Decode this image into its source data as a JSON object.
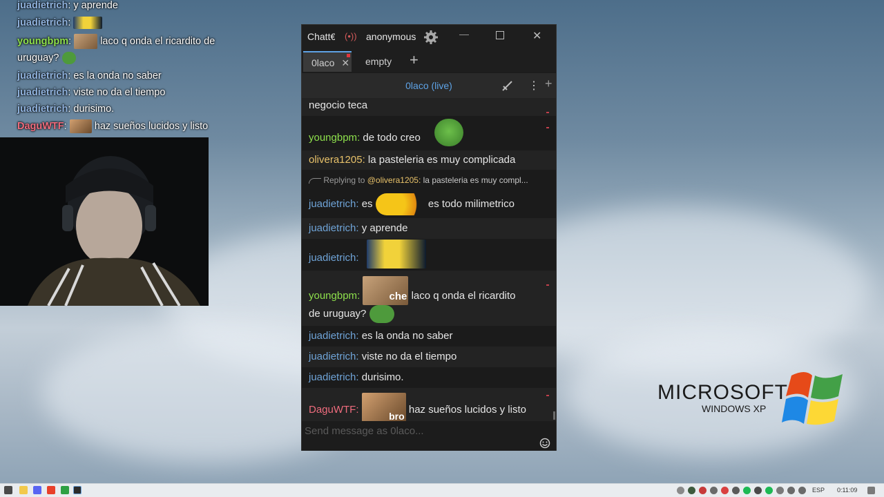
{
  "overlay_chat": [
    {
      "user": "juadietrich",
      "sep": ":",
      "text": "y aprende",
      "color": "#8fb1dc"
    },
    {
      "user": "juadietrich",
      "sep": ":",
      "text": "",
      "color": "#8fb1dc",
      "emote": "minion-emote"
    },
    {
      "user": "youngbpm",
      "sep": ":",
      "text": "laco q onda el ricardito de",
      "color": "#8ee04c",
      "emote": "cat-che-emote"
    },
    {
      "user": "",
      "sep": "",
      "text": "uruguay?",
      "color": "#ffffff",
      "emote": "pepe-emote"
    },
    {
      "user": "juadietrich",
      "sep": ":",
      "text": "es la onda no saber",
      "color": "#8fb1dc"
    },
    {
      "user": "juadietrich",
      "sep": ":",
      "text": "viste no da el tiempo",
      "color": "#8fb1dc"
    },
    {
      "user": "juadietrich",
      "sep": ":",
      "text": "durisimo.",
      "color": "#8fb1dc"
    },
    {
      "user": "DaguWTF",
      "sep": ":",
      "text": "haz sueños lucidos y listo",
      "color": "#ee6c7d",
      "emote": "cat-bro-emote"
    }
  ],
  "window": {
    "title": "Chatterino",
    "title_visible": "Chatt€",
    "account": "anonymous",
    "tabs": [
      {
        "label": "0laco"
      },
      {
        "label": "empty"
      }
    ],
    "add_tab": "+",
    "channel": "0laco (live)",
    "input_placeholder": "Send message as 0laco..."
  },
  "messages": [
    {
      "user": "",
      "text": "negocio teca",
      "style": "alt"
    },
    {
      "user": "youngbpm",
      "text": "de todo creo",
      "emote": "pepe-sunglasses-emote"
    },
    {
      "user": "olivera1205",
      "text": "la pasteleria es muy complicada",
      "style": "alt"
    },
    {
      "reply_prefix": "Replying to",
      "reply_user": "@olivera1205:",
      "reply_text": "la pasteleria es muy compl..."
    },
    {
      "user": "juadietrich",
      "text_before": "es",
      "text": "es todo milimetrico",
      "emote": "sunglasses-point-emote"
    },
    {
      "user": "juadietrich",
      "text": "y aprende",
      "style": "alt"
    },
    {
      "user": "juadietrich",
      "text": "",
      "emote": "minion-emote"
    },
    {
      "user": "youngbpm",
      "text": "laco q onda el ricardito",
      "text2": "de uruguay?",
      "emote": "cat-che-emote",
      "style": "alt"
    },
    {
      "user": "juadietrich",
      "text": "es la onda no saber"
    },
    {
      "user": "juadietrich",
      "text": "viste no da el tiempo",
      "style": "alt"
    },
    {
      "user": "juadietrich",
      "text": "durisimo."
    },
    {
      "user": "DaguWTF",
      "text": "haz sueños lucidos y listo",
      "emote": "cat-bro-emote",
      "style": "alt"
    }
  ],
  "emote_labels": {
    "che": "che",
    "bro": "bro"
  },
  "desktop": {
    "brand_line1": "MICROSOFT",
    "brand_line2": "WINDOWS XP"
  },
  "taskbar": {
    "lang": "ESP",
    "clock": "0:11:09"
  },
  "colors": {
    "youngbpm": "#8ee04c",
    "olivera1205": "#e8c26a",
    "juadietrich": "#6fa4d8",
    "DaguWTF": "#ee6c7d",
    "channel_live": "#5ea3e6"
  }
}
